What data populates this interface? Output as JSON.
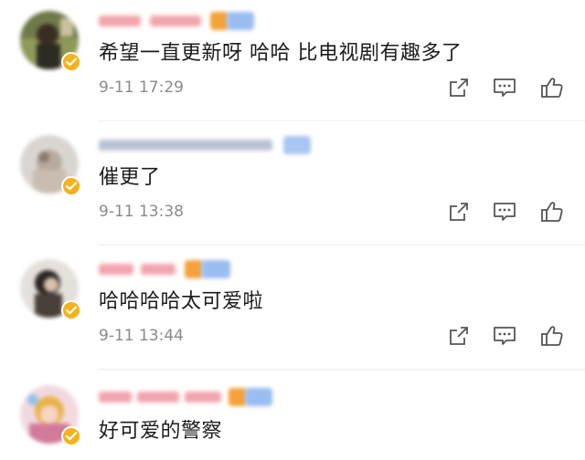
{
  "comments": [
    {
      "text": "希望一直更新呀 哈哈 比电视剧有趣多了",
      "time": "9-11 17:29",
      "avatar_icon": "user-avatar-icon",
      "verified_icon": "verified-check-icon"
    },
    {
      "text": "催更了",
      "time": "9-11 13:38",
      "avatar_icon": "user-avatar-icon",
      "verified_icon": "verified-check-icon"
    },
    {
      "text": "哈哈哈哈太可爱啦",
      "time": "9-11 13:44",
      "avatar_icon": "user-avatar-icon",
      "verified_icon": "verified-check-icon"
    },
    {
      "text": "好可爱的警察",
      "time": "",
      "avatar_icon": "user-avatar-icon",
      "verified_icon": "verified-check-icon"
    }
  ],
  "actions": {
    "share_icon": "share-icon",
    "comment_icon": "comment-icon",
    "like_icon": "like-thumb-icon"
  },
  "colors": {
    "name_blur": "#f0a9b0",
    "name_blur_gray": "#b8c0d6",
    "badge_orange": "#f4a23a",
    "badge_blue": "#8fb4ee",
    "verified": "#f6b21a",
    "text": "#1c1c1c",
    "meta": "#8a8a8a",
    "icon": "#555555"
  }
}
